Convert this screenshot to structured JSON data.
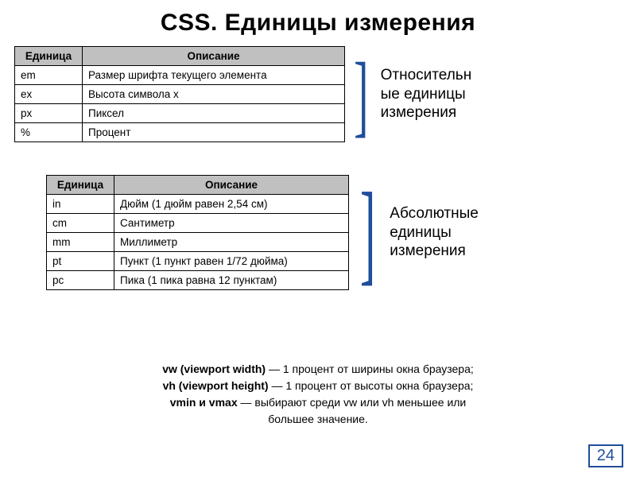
{
  "title": "CSS. Единицы измерения",
  "table1": {
    "header_unit": "Единица",
    "header_desc": "Описание",
    "rows": [
      {
        "unit": "em",
        "desc": "Размер шрифта текущего элемента"
      },
      {
        "unit": "ex",
        "desc": "Высота символа x"
      },
      {
        "unit": "px",
        "desc": "Пиксел"
      },
      {
        "unit": "%",
        "desc": "Процент"
      }
    ],
    "label_line1": "Относительн",
    "label_line2": "ые единицы",
    "label_line3": "измерения"
  },
  "table2": {
    "header_unit": "Единица",
    "header_desc": "Описание",
    "rows": [
      {
        "unit": "in",
        "desc": "Дюйм (1 дюйм равен 2,54 см)"
      },
      {
        "unit": "cm",
        "desc": "Сантиметр"
      },
      {
        "unit": "mm",
        "desc": "Миллиметр"
      },
      {
        "unit": "pt",
        "desc": "Пункт (1 пункт равен 1/72 дюйма)"
      },
      {
        "unit": "pc",
        "desc": "Пика (1 пика равна 12 пунктам)"
      }
    ],
    "label_line1": "Абсолютные",
    "label_line2": "единицы",
    "label_line3": "измерения"
  },
  "footer": {
    "l1b": "vw (viewport width)",
    "l1": " — 1 процент от ширины окна браузера;",
    "l2b": "vh (viewport height)",
    "l2": " — 1 процент от высоты окна браузера;",
    "l3b": "vmin и vmax",
    "l3": " — выбирают среди vw или vh меньшее или",
    "l4": "большее значение."
  },
  "page": "24",
  "brace": "]"
}
